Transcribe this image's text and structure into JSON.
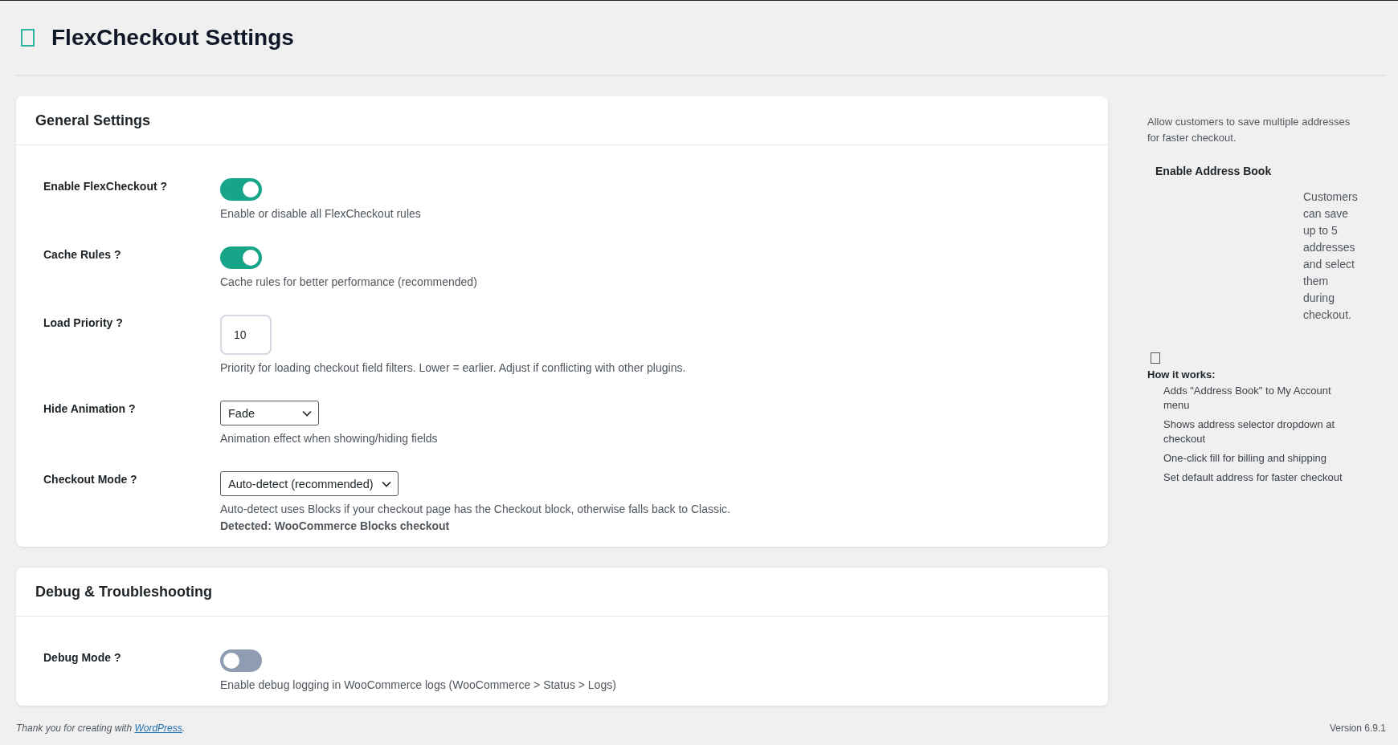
{
  "page": {
    "title": "FlexCheckout Settings"
  },
  "sections": [
    {
      "title": "General Settings",
      "fields": [
        {
          "kind": "toggle",
          "label": "Enable FlexCheckout ?",
          "on": true,
          "description": "Enable or disable all FlexCheckout rules"
        },
        {
          "kind": "toggle",
          "label": "Cache Rules ?",
          "on": true,
          "description": "Cache rules for better performance (recommended)"
        },
        {
          "kind": "number",
          "label": "Load Priority ?",
          "value": "10",
          "description": "Priority for loading checkout field filters. Lower = earlier. Adjust if conflicting with other plugins."
        },
        {
          "kind": "select",
          "label": "Hide Animation ?",
          "value": "Fade",
          "description": "Animation effect when showing/hiding fields"
        },
        {
          "kind": "select",
          "label": "Checkout Mode ?",
          "value": "Auto-detect (recommended)",
          "description": "Auto-detect uses Blocks if your checkout page has the Checkout block, otherwise falls back to Classic.",
          "note": "Detected: WooCommerce Blocks checkout"
        }
      ]
    },
    {
      "title": "Debug & Troubleshooting",
      "fields": [
        {
          "kind": "toggle",
          "label": "Debug Mode ?",
          "on": false,
          "description": "Enable debug logging in WooCommerce logs (WooCommerce > Status > Logs)"
        }
      ]
    }
  ],
  "sidebar": {
    "intro": "Allow customers to save multiple addresses for faster checkout.",
    "setting_label": "Enable Address Book",
    "setting_description": "Customers can save up to 5 addresses and select them during checkout.",
    "how_title": "How it works:",
    "how_items": [
      "Adds \"Address Book\" to My Account menu",
      "Shows address selector dropdown at checkout",
      "One-click fill for billing and shipping",
      "Set default address for faster checkout"
    ]
  },
  "footer": {
    "thanks": "Thank you for creating with ",
    "link": "WordPress",
    "after": ".",
    "version": "Version 6.9.1"
  }
}
